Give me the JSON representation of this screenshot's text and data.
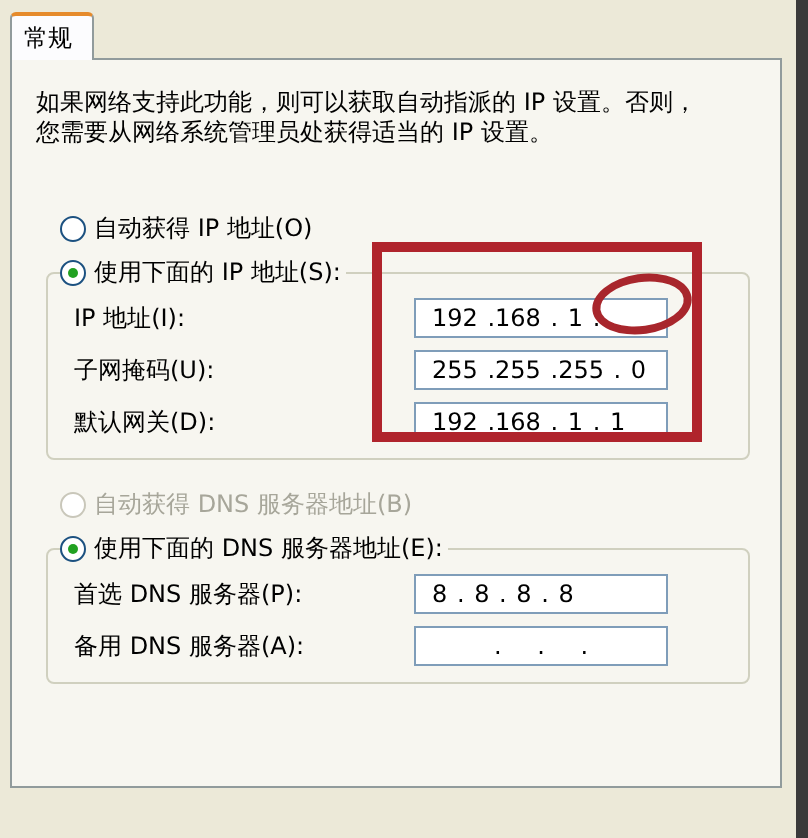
{
  "tabs": [
    {
      "label": "常规",
      "selected": true
    }
  ],
  "description_lines": [
    "如果网络支持此功能，则可以获取自动指派的 IP 设置。否则，",
    "您需要从网络系统管理员处获得适当的 IP 设置。"
  ],
  "ip_section": {
    "options": [
      {
        "label": "自动获得 IP 地址(O)",
        "selected": false,
        "disabled": false
      },
      {
        "label": "使用下面的 IP 地址(S):",
        "selected": true,
        "disabled": false
      }
    ],
    "fields": [
      {
        "label": "IP 地址(I):",
        "value": "192 .168 . 1 ."
      },
      {
        "label": "子网掩码(U):",
        "value": "255 .255 .255 . 0"
      },
      {
        "label": "默认网关(D):",
        "value": "192 .168 . 1 . 1"
      }
    ]
  },
  "dns_section": {
    "options": [
      {
        "label": "自动获得 DNS 服务器地址(B)",
        "selected": false,
        "disabled": true
      },
      {
        "label": "使用下面的 DNS 服务器地址(E):",
        "selected": true,
        "disabled": false
      }
    ],
    "fields": [
      {
        "label": "首选 DNS 服务器(P):",
        "value": "8 . 8 . 8 . 8"
      },
      {
        "label": "备用 DNS 服务器(A):",
        "value": ". . ."
      }
    ]
  },
  "annotations": [
    {
      "kind": "frame",
      "color": "#b0242c"
    },
    {
      "kind": "circle",
      "color": "#a8262c"
    }
  ]
}
